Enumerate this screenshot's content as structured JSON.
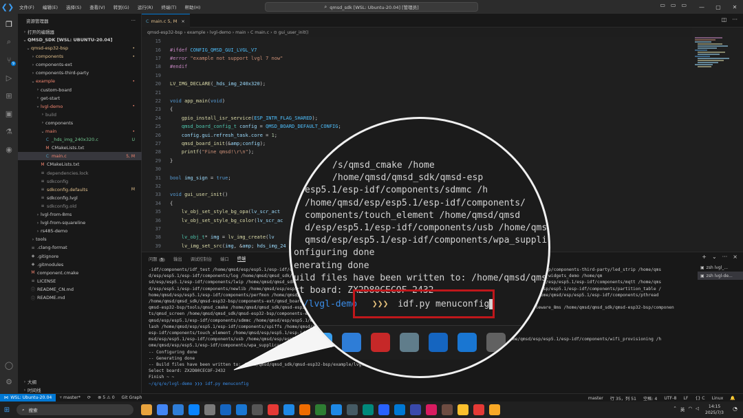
{
  "titlebar": {
    "menus": [
      "文件(F)",
      "编辑(E)",
      "选择(S)",
      "查看(V)",
      "转到(G)",
      "运行(R)",
      "终端(T)",
      "帮助(H)"
    ],
    "search": "qmsd_sdk [WSL: Ubuntu-20.04] [管理员]"
  },
  "sidebar": {
    "header": "资源管理器",
    "open_editors": "打开的编辑器",
    "workspace": "QMSD_SDK [WSL: UBUNTU-20.04]",
    "tree": [
      {
        "label": "qmsd-esp32-bsp",
        "indent": 1,
        "chev": "⌄",
        "color": "orange",
        "status": "•",
        "statusColor": "orange"
      },
      {
        "label": "components",
        "indent": 2,
        "chev": "›",
        "color": "orange",
        "status": "•",
        "statusColor": "orange"
      },
      {
        "label": "components-ext",
        "indent": 2,
        "chev": "›",
        "color": "default",
        "status": "",
        "statusColor": ""
      },
      {
        "label": "components-third-party",
        "indent": 2,
        "chev": "›",
        "color": "default",
        "status": "",
        "statusColor": ""
      },
      {
        "label": "example",
        "indent": 2,
        "chev": "⌄",
        "color": "red",
        "status": "•",
        "statusColor": "red"
      },
      {
        "label": "custom-board",
        "indent": 3,
        "chev": "›",
        "color": "default",
        "status": "",
        "statusColor": ""
      },
      {
        "label": "get-start",
        "indent": 3,
        "chev": "›",
        "color": "default",
        "status": "",
        "statusColor": ""
      },
      {
        "label": "lvgl-demo",
        "indent": 3,
        "chev": "⌄",
        "color": "red",
        "status": "•",
        "statusColor": "red"
      },
      {
        "label": "build",
        "indent": 4,
        "chev": "›",
        "color": "gray",
        "status": "",
        "statusColor": ""
      },
      {
        "label": "components",
        "indent": 4,
        "chev": "›",
        "color": "default",
        "status": "",
        "statusColor": ""
      },
      {
        "label": "main",
        "indent": 4,
        "chev": "⌄",
        "color": "red",
        "status": "•",
        "statusColor": "red"
      },
      {
        "label": "_hds_img_240x320.c",
        "indent": 5,
        "chev": "",
        "icon": "C",
        "color": "green",
        "status": "U",
        "statusColor": "green"
      },
      {
        "label": "CMakeLists.txt",
        "indent": 5,
        "chev": "",
        "icon": "M",
        "color": "default",
        "status": "",
        "statusColor": ""
      },
      {
        "label": "main.c",
        "indent": 5,
        "chev": "",
        "icon": "C",
        "color": "red",
        "status": "5, M",
        "statusColor": "red",
        "selected": true
      },
      {
        "label": "CMakeLists.txt",
        "indent": 4,
        "chev": "",
        "icon": "M",
        "color": "default",
        "status": "",
        "statusColor": ""
      },
      {
        "label": "dependencies.lock",
        "indent": 4,
        "chev": "",
        "icon": "≡",
        "color": "gray",
        "status": "",
        "statusColor": ""
      },
      {
        "label": "sdkconfig",
        "indent": 4,
        "chev": "",
        "icon": "≡",
        "color": "gray",
        "status": "",
        "statusColor": ""
      },
      {
        "label": "sdkconfig.defaults",
        "indent": 4,
        "chev": "",
        "icon": "≡",
        "color": "orange",
        "status": "M",
        "statusColor": "orange"
      },
      {
        "label": "sdkconfig.lvgl",
        "indent": 4,
        "chev": "",
        "icon": "≡",
        "color": "default",
        "status": "",
        "statusColor": ""
      },
      {
        "label": "sdkconfig.old",
        "indent": 4,
        "chev": "",
        "icon": "≡",
        "color": "gray",
        "status": "",
        "statusColor": ""
      },
      {
        "label": "lvgl-from-8ms",
        "indent": 3,
        "chev": "›",
        "color": "default",
        "status": "",
        "statusColor": ""
      },
      {
        "label": "lvgl-from-squareline",
        "indent": 3,
        "chev": "›",
        "color": "default",
        "status": "",
        "statusColor": ""
      },
      {
        "label": "rs485-demo",
        "indent": 3,
        "chev": "›",
        "color": "default",
        "status": "",
        "statusColor": ""
      },
      {
        "label": "tools",
        "indent": 2,
        "chev": "›",
        "color": "default",
        "status": "",
        "statusColor": ""
      },
      {
        "label": ".clang-format",
        "indent": 2,
        "chev": "",
        "icon": "≡",
        "color": "default",
        "status": "",
        "statusColor": ""
      },
      {
        "label": ".gitignore",
        "indent": 2,
        "chev": "",
        "icon": "◆",
        "color": "default",
        "status": "",
        "statusColor": ""
      },
      {
        "label": ".gitmodules",
        "indent": 2,
        "chev": "",
        "icon": "◆",
        "color": "default",
        "status": "",
        "statusColor": ""
      },
      {
        "label": "component.cmake",
        "indent": 2,
        "chev": "",
        "icon": "M",
        "color": "default",
        "status": "",
        "statusColor": ""
      },
      {
        "label": "LICENSE",
        "indent": 2,
        "chev": "",
        "icon": "≡",
        "color": "default",
        "status": "",
        "statusColor": ""
      },
      {
        "label": "README_CN.md",
        "indent": 2,
        "chev": "",
        "icon": "ⓘ",
        "color": "default",
        "status": "",
        "statusColor": ""
      },
      {
        "label": "README.md",
        "indent": 2,
        "chev": "",
        "icon": "ⓘ",
        "color": "default",
        "status": "",
        "statusColor": ""
      }
    ],
    "outline": "大纲",
    "timeline": "时间线"
  },
  "editor": {
    "tab_label": "main.c 5, M",
    "breadcrumb": "qmsd-esp32-bsp › example › lvgl-demo › main › C main.c › ⊙ gui_user_init()",
    "lines": [
      {
        "n": "15",
        "t": ""
      },
      {
        "n": "16",
        "t": "#ifdef CONFIG_QMSD_GUI_LVGL_V7"
      },
      {
        "n": "17",
        "t": "#error \"example not support lvgl 7 now\""
      },
      {
        "n": "18",
        "t": "#endif"
      },
      {
        "n": "19",
        "t": ""
      },
      {
        "n": "20",
        "t": "LV_IMG_DECLARE(_hds_img_240x320);"
      },
      {
        "n": "21",
        "t": ""
      },
      {
        "n": "22",
        "t": "void app_main(void)"
      },
      {
        "n": "23",
        "t": "{"
      },
      {
        "n": "24",
        "t": "    gpio_install_isr_service(ESP_INTR_FLAG_SHARED);"
      },
      {
        "n": "25",
        "t": "    qmsd_board_config_t config = QMSD_BOARD_DEFAULT_CONFIG;"
      },
      {
        "n": "26",
        "t": "    config.gui.refresh_task.core = 1;"
      },
      {
        "n": "27",
        "t": "    qmsd_board_init(&config);"
      },
      {
        "n": "28",
        "t": "    printf(\"Fine qmsd!\\r\\n\");"
      },
      {
        "n": "29",
        "t": "}"
      },
      {
        "n": "30",
        "t": ""
      },
      {
        "n": "31",
        "t": "bool img_sign = true;"
      },
      {
        "n": "32",
        "t": ""
      },
      {
        "n": "33",
        "t": "void gui_user_init()"
      },
      {
        "n": "34",
        "t": "{"
      },
      {
        "n": "35",
        "t": "    lv_obj_set_style_bg_opa(lv_scr_act"
      },
      {
        "n": "36",
        "t": "    lv_obj_set_style_bg_color(lv_scr_ac"
      },
      {
        "n": "37",
        "t": ""
      },
      {
        "n": "38",
        "t": "    lv_obj_t* img = lv_img_create(lv"
      },
      {
        "n": "39",
        "t": "    lv_img_set_src(img, & hds_img_24"
      }
    ]
  },
  "panel": {
    "tabs": [
      "问题",
      "输出",
      "调试控制台",
      "端口",
      "终端"
    ],
    "problem_count": "5",
    "terminal_lines": [
      "-idf/components/idf_test /home/qmsd/esp/esp5.1/esp-idf/components/ieee802154 /home/qmsd/esp/esp5.1/esp-idf/components/json /home/qmsd/qmsd_sdk/qmsd-esp32-bsp/components-third-party/led_strip /home/qms",
      "d/esp/esp5.1/esp-idf/components/log /home/qmsd/qmsd_sdk/qmsd-esp32-bsp/components/lvgl /home/qmsd/qmsd_sdk/qmsd-esp32-bsp/example/lvgl-demo/components/lvgl_widgets_demo /home/qm",
      "sd/esp/esp5.1/esp-idf/components/lwip /home/qmsd/qmsd_sdk/qmsd-esp32-bsp/example/lvgl-demo/main /home/qmsd/esp/esp5.1/esp-idf/components/mbedtls /home/qmsd/esp/esp5.1/esp-idf/components/mqtt /home/qms",
      "d/esp/esp5.1/esp-idf/components/newlib /home/qmsd/esp/esp5.1/esp-idf/components/nvs_flash /home/qmsd/esp/esp5.1/esp-idf/components/openthread /home/qmsd/esp/esp5.1/esp-idf/components/partition_table /",
      "home/qmsd/esp/esp5.1/esp-idf/components/perfmon /home/qmsd/esp/esp5.1/esp-idf/components/protobuf-c /home/qmsd/esp/esp5.1/esp-idf/components/protocomm /home/qmsd/esp/esp5.1/esp-idf/components/pthread",
      "/home/qmsd/qmsd_sdk/qmsd-esp32-bsp/components-ext/qmsd_board /home/qmsd/qmsd_sdk/qmsd-esp32-bsp/components-ext/qmsd_button /home/qmsd/qmsd_sdk/",
      "qmsd-esp32-bsp/tools/qmsd_cmake /home/qmsd/qmsd_sdk/qmsd-esp32-bsp/components-ext/qmsd_ctrl /home/qmsd/qmsd_sdk/qmsd-esp32-bsp/components-ext/qmsd_middleware_8ms /home/qmsd/qmsd_sdk/qmsd-esp32-bsp/componen",
      "ts/qmsd_screen /home/qmsd/qmsd_sdk/qmsd-esp32-bsp/components-ext/qmsd_touch /home/qmsd/qmsd_sdk/qmsd-esp32-bsp/components-third-party/screen /home/",
      "qmsd/esp/esp5.1/esp-idf/components/sdmmc /home/qmsd/esp/esp5.1/esp-idf/components/soc /home/qmsd/esp/esp5.1/esp-idf/components/spi_f",
      "lash /home/qmsd/esp/esp5.1/esp-idf/components/spiffs /home/qmsd/qmsd_sdk/qmsd-esp32-bsp/components-ext/qmsd_sensor/tm1629a /home/qmsd/esp/esp5.1/",
      "esp-idf/components/touch_element /home/qmsd/esp/esp5.1/esp-idf/components/ulp /home/qmsd/esp/esp5.1/esp-idf/components/unity /home/q",
      "msd/esp/esp5.1/esp-idf/components/usb /home/qmsd/esp/esp5.1/esp-idf/components/vfs /home/qmsd/esp/esp5.1/esp-idf/components/wear_levelling /home/qmsd/esp/esp5.1/esp-idf/components/wifi_provisioning /h",
      "ome/qmsd/esp/esp5.1/esp-idf/components/wpa_supplicant /home/qmsd/esp/esp5.1/esp-idf/components/xtensa",
      "-- Configuring done",
      "-- Generating done",
      "-- Build files have been written to: /home/qmsd/qmsd_sdk/qmsd-esp32-bsp/example/lvgl-demo/build",
      "Select board: ZX2D80CECOF-2432",
      "Finish ~ ~",
      "~/q/q/e/lvgl-demo ❯❯❯ idf.py menuconfig"
    ],
    "terminals": [
      "zsh  lvgl_...",
      "zsh  lvgl-de..."
    ]
  },
  "statusbar": {
    "remote": "WSL: Ubuntu-20.04",
    "branch": "master*",
    "sync": "⟳",
    "problems": "⊗ 5 ⚠ 0",
    "graph": "Git Graph",
    "branch_right": "master",
    "position": "行 35，列 51",
    "spaces": "空格: 4",
    "encoding": "UTF-8",
    "eol": "LF",
    "lang": "{} C",
    "platform": "Linux"
  },
  "taskbar": {
    "search": "搜索",
    "time": "14:15",
    "date": "2025/7/3",
    "lang": "英"
  },
  "magnifier": {
    "lines": [
      "/s/qmsd_cmake /home",
      "/home/qmsd/qmsd_sdk/qmsd-esp",
      "esp5.1/esp-idf/components/sdmmc /h",
      "/home/qmsd/esp/esp5.1/esp-idf/components/",
      "components/touch_element /home/qmsd/qmsd",
      "d/esp/esp5.1/esp-idf/components/usb /home/qmsd/",
      "qmsd/esp/esp5.1/esp-idf/components/wpa_supplic",
      "onfiguring done",
      "enerating done",
      "uild files have been written to: /home/qmsd/qms",
      "ct board: ZX2D80CECOF-2432"
    ],
    "prompt_path": "e/lvgl-demo",
    "prompt_arrows": "❯❯❯",
    "command": "idf.py menuconfig"
  },
  "colors": {
    "accent": "#0078d4",
    "highlight": "#c0171b"
  }
}
